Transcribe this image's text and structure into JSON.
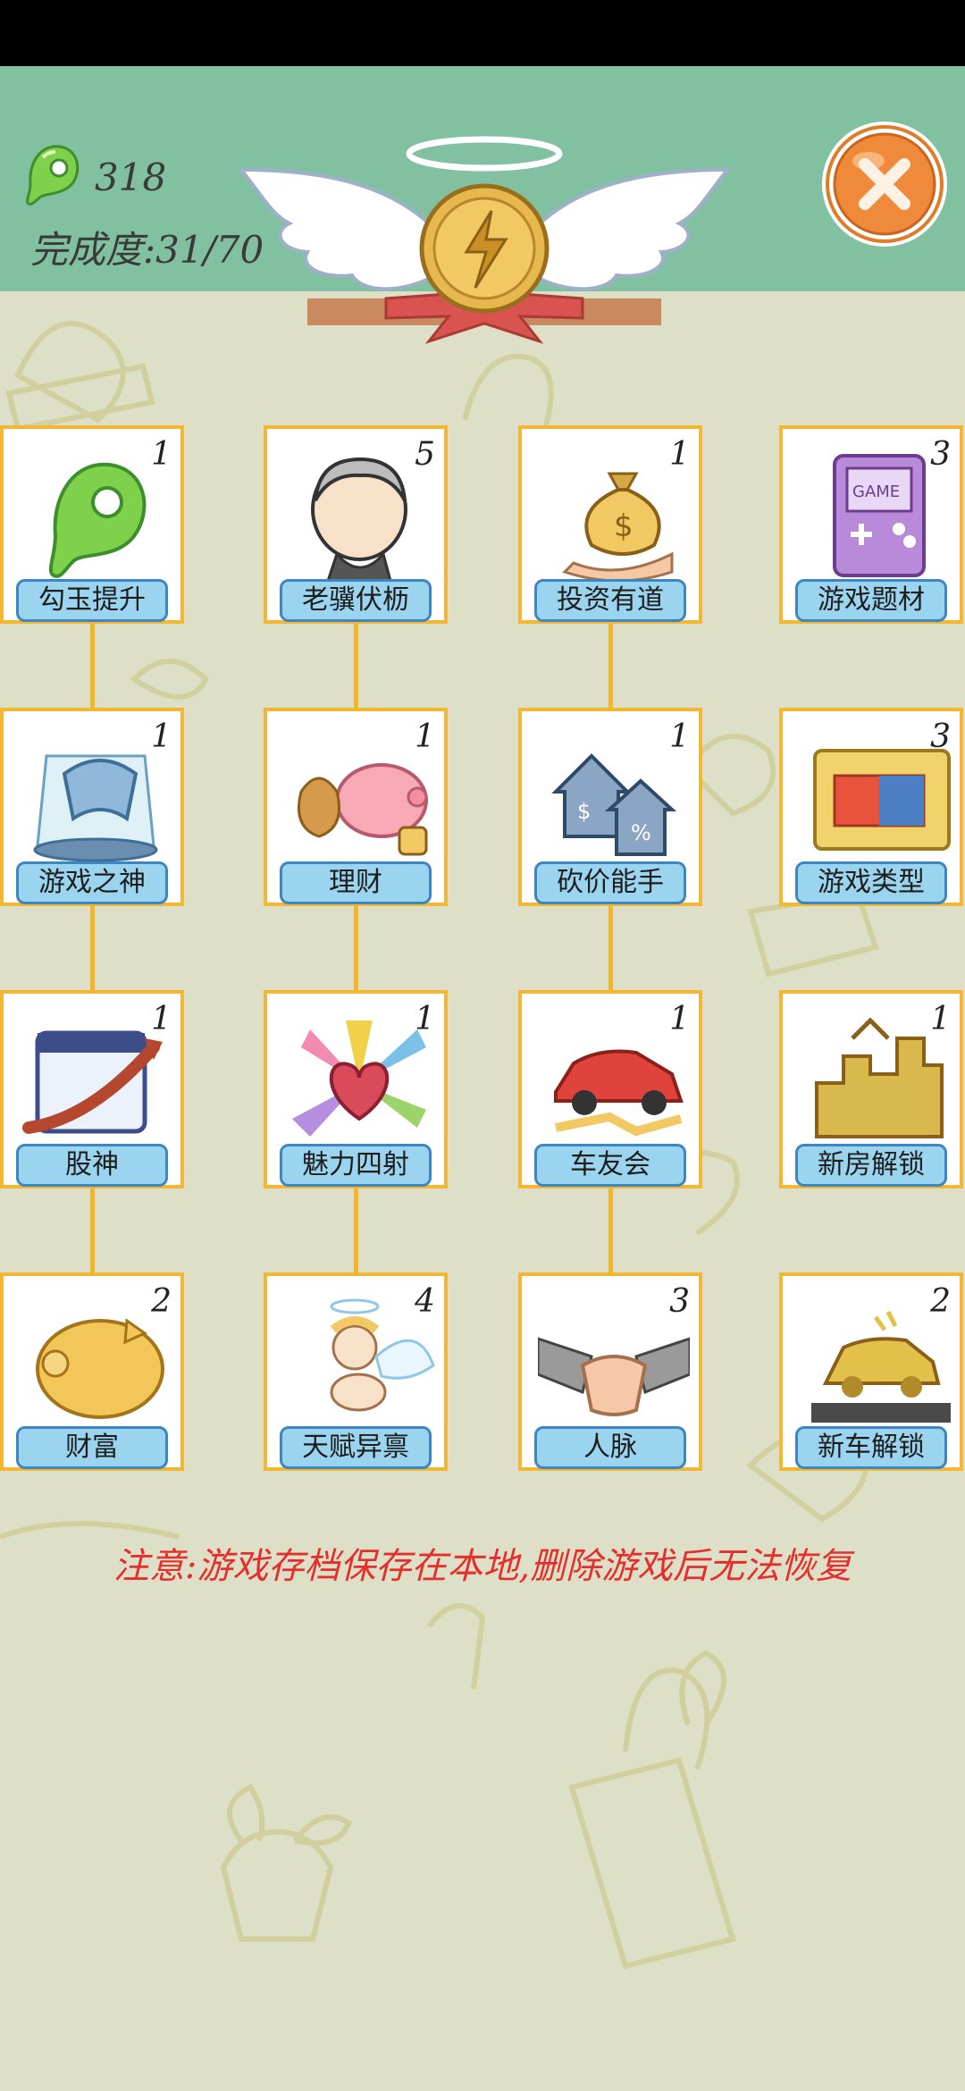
{
  "header": {
    "points": "318",
    "progress": "完成度:31/70"
  },
  "colors": {
    "header_bg": "#82c0a2",
    "page_bg": "#dde0c6",
    "card_border": "#f4b733",
    "label_bg": "#9bd4ee",
    "label_border": "#3e86c2",
    "notice": "#e3302e",
    "close_button": "#ef8a3a"
  },
  "skills": [
    {
      "label": "勾玉提升",
      "count": "1",
      "icon": "green-magatama-icon"
    },
    {
      "label": "老骥伏枥",
      "count": "5",
      "icon": "old-man-icon"
    },
    {
      "label": "投资有道",
      "count": "1",
      "icon": "money-bag-icon"
    },
    {
      "label": "游戏题材",
      "count": "3",
      "icon": "game-console-icon"
    },
    {
      "label": "游戏之神",
      "count": "1",
      "icon": "controller-trophy-icon"
    },
    {
      "label": "理财",
      "count": "1",
      "icon": "piggy-bank-icon"
    },
    {
      "label": "砍价能手",
      "count": "1",
      "icon": "houses-discount-icon"
    },
    {
      "label": "游戏类型",
      "count": "3",
      "icon": "game-cartridge-icon"
    },
    {
      "label": "股神",
      "count": "1",
      "icon": "stock-chart-icon"
    },
    {
      "label": "魅力四射",
      "count": "1",
      "icon": "heart-burst-icon"
    },
    {
      "label": "车友会",
      "count": "1",
      "icon": "red-car-icon"
    },
    {
      "label": "新房解锁",
      "count": "1",
      "icon": "gold-buildings-icon"
    },
    {
      "label": "财富",
      "count": "2",
      "icon": "gold-pig-icon"
    },
    {
      "label": "天赋异禀",
      "count": "4",
      "icon": "cupid-icon"
    },
    {
      "label": "人脉",
      "count": "3",
      "icon": "handshake-icon"
    },
    {
      "label": "新车解锁",
      "count": "2",
      "icon": "gold-car-icon"
    }
  ],
  "notice": "注意:游戏存档保存在本地,删除游戏后无法恢复"
}
